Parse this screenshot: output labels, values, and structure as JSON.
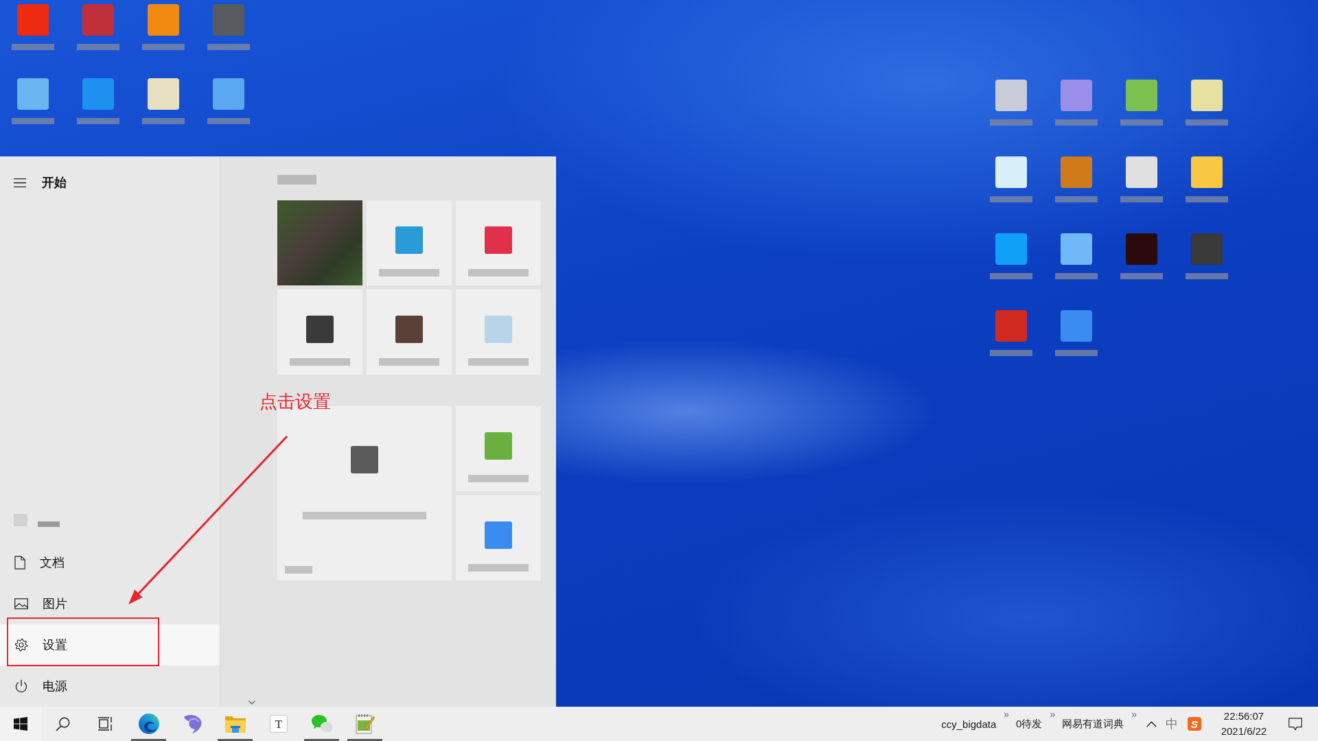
{
  "desktop_icons_left": [
    {
      "color": "#ee2a10"
    },
    {
      "color": "#c0303a"
    },
    {
      "color": "#f08a10"
    },
    {
      "color": "#575a5f"
    },
    {
      "color": "#6ab4f0"
    },
    {
      "color": "#1e90f0"
    },
    {
      "color": "#e6e0c0"
    },
    {
      "color": "#5aa8f0"
    }
  ],
  "desktop_icons_right": [
    {
      "color": "#c8ccd8"
    },
    {
      "color": "#9a8ee8"
    },
    {
      "color": "#7cc050"
    },
    {
      "color": "#e8e0a0"
    },
    {
      "color": "#d8eef8"
    },
    {
      "color": "#d07a1a"
    },
    {
      "color": "#e0e0e0"
    },
    {
      "color": "#f8c840"
    },
    {
      "color": "#10a0f8"
    },
    {
      "color": "#70b8f8"
    },
    {
      "color": "#2a0a0a"
    },
    {
      "color": "#3a3a3a"
    },
    {
      "color": "#d02a20"
    },
    {
      "color": "#3a8cf0"
    }
  ],
  "start_menu": {
    "title": "开始",
    "items": [
      {
        "kind": "user",
        "selected": false,
        "annotated": false
      },
      {
        "kind": "documents",
        "label": "文档",
        "selected": false,
        "annotated": false
      },
      {
        "kind": "pictures",
        "label": "图片",
        "selected": false,
        "annotated": false
      },
      {
        "kind": "settings",
        "label": "设置",
        "selected": true,
        "annotated": true
      },
      {
        "kind": "power",
        "label": "电源",
        "selected": false,
        "annotated": false
      }
    ],
    "tile_groups": [
      {
        "blurred_title": true,
        "tiles": [
          {
            "kind": "photo"
          },
          {
            "kind": "app",
            "color": "#2a9ad8"
          },
          {
            "kind": "app",
            "color": "#e0304a"
          },
          {
            "kind": "app",
            "color": "#3a3a3a"
          },
          {
            "kind": "app",
            "color": "#5a4036"
          },
          {
            "kind": "app",
            "color": "#b8d4e8"
          }
        ]
      },
      {
        "blurred_title": false,
        "tiles": [
          {
            "kind": "large_app",
            "color": "#5a5a5a"
          },
          {
            "kind": "app",
            "color": "#6ab040"
          },
          {
            "kind": "app",
            "color": "#3a8cf0"
          }
        ]
      }
    ]
  },
  "annotation": {
    "text": "点击设置"
  },
  "taskbar": {
    "apps": [
      {
        "kind": "swirl",
        "running": true
      },
      {
        "kind": "dolphin",
        "running": false
      },
      {
        "kind": "folder",
        "running": true
      },
      {
        "kind": "letter",
        "glyph": "T",
        "running": false
      },
      {
        "kind": "chat",
        "running": true
      },
      {
        "kind": "notepad",
        "running": true
      }
    ],
    "toolbars": [
      {
        "label": "ccy_bigdata",
        "chevron": "»"
      },
      {
        "label": "0待发",
        "chevron": "»"
      },
      {
        "label": "网易有道词典",
        "chevron": "»"
      }
    ],
    "tray": {
      "ime": "中",
      "ime_logo": "S"
    },
    "clock": {
      "time": "22:56:07",
      "date": "2021/6/22"
    }
  }
}
